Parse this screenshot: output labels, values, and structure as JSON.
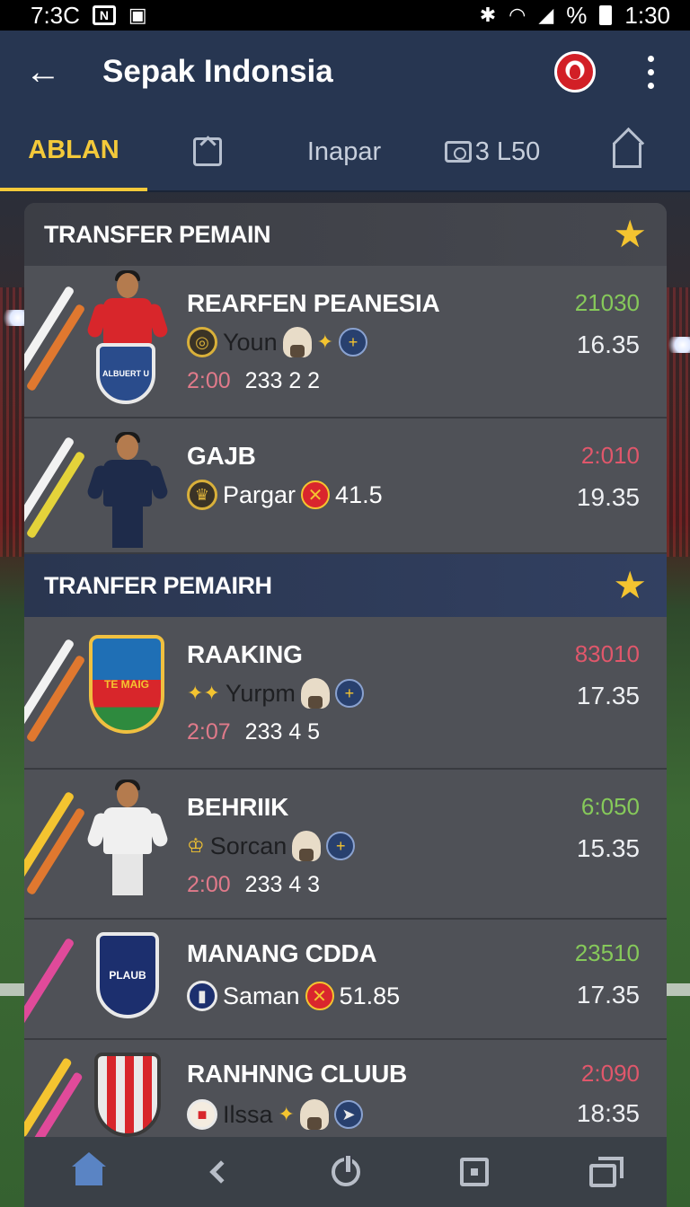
{
  "status_bar": {
    "time_left": "7:3C",
    "box_label": "N",
    "percent": "%",
    "time_right": "1:30"
  },
  "app_bar": {
    "title": "Sepak Indonsia"
  },
  "tabs": [
    {
      "label": "ABLAN",
      "active": true
    },
    {
      "label": "",
      "icon": "upload-box-icon"
    },
    {
      "label": "Inapar"
    },
    {
      "label": "3 L50",
      "icon": "camera-icon"
    },
    {
      "label": "",
      "icon": "home-outline-icon"
    }
  ],
  "sections": [
    {
      "title": "TRANSFER PEMAIN",
      "rows": [
        {
          "name": "REARFEN PEANESIA",
          "meta": "Youn",
          "time": "2:00",
          "score": "233 2 2",
          "stat_top": "21030",
          "stat_top_color": "green",
          "stat_bottom": "16.35",
          "crest_text": "ALBUERT U"
        },
        {
          "name": "GAJB",
          "meta": "Pargar",
          "extra": "41.5",
          "stat_top": "2:010",
          "stat_top_color": "red",
          "stat_bottom": "19.35"
        }
      ]
    },
    {
      "title": "TRANFER PEMAIRH",
      "rows": [
        {
          "name": "RAAKING",
          "meta": "Yurpm",
          "time": "2:07",
          "score": "233 4 5",
          "stat_top": "83010",
          "stat_top_color": "red",
          "stat_bottom": "17.35",
          "crest_text": "TE MAIG"
        },
        {
          "name": "BEHRIIK",
          "meta": "Sorcan",
          "time": "2:00",
          "score": "233 4 3",
          "stat_top": "6:050",
          "stat_top_color": "green",
          "stat_bottom": "15.35"
        },
        {
          "name": "MANANG CDDA",
          "meta": "Saman",
          "extra": "51.85",
          "stat_top": "23510",
          "stat_top_color": "green",
          "stat_bottom": "17.35",
          "crest_text": "PLAUB"
        },
        {
          "name": "RANHNNG CLUUB",
          "meta": "Ilssa",
          "stat_top": "2:090",
          "stat_top_color": "red",
          "stat_bottom": "18:35"
        }
      ]
    }
  ],
  "colors": {
    "accent": "#f3c93a",
    "appbar": "#273651",
    "panel": "#4f5157",
    "green": "#86c95a",
    "red": "#e0576b"
  }
}
